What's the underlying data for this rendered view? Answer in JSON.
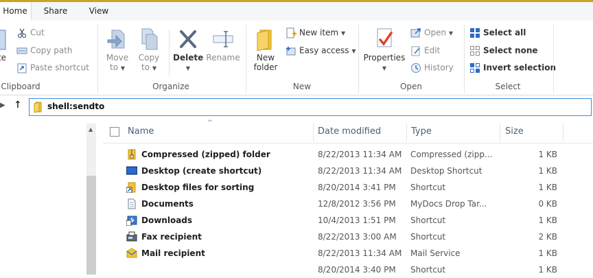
{
  "tabs": [
    "Home",
    "Share",
    "View"
  ],
  "clipboard": {
    "paste_partial": "te",
    "cut": "Cut",
    "copy_path": "Copy path",
    "paste_shortcut": "Paste shortcut",
    "label": "Clipboard"
  },
  "organize": {
    "move_to_1": "Move",
    "move_to_2": "to",
    "copy_to_1": "Copy",
    "copy_to_2": "to",
    "delete": "Delete",
    "rename": "Rename",
    "label": "Organize"
  },
  "new": {
    "new_folder_1": "New",
    "new_folder_2": "folder",
    "new_item": "New item",
    "easy_access": "Easy access",
    "label": "New"
  },
  "open": {
    "properties": "Properties",
    "open": "Open",
    "edit": "Edit",
    "history": "History",
    "label": "Open"
  },
  "select": {
    "select_all": "Select all",
    "select_none": "Select none",
    "invert_selection": "Invert selection",
    "label": "Select"
  },
  "address": {
    "path": "shell:sendto"
  },
  "columns": {
    "name": "Name",
    "date": "Date modified",
    "type": "Type",
    "size": "Size"
  },
  "files": [
    {
      "name": "Compressed (zipped) folder",
      "date": "8/22/2013 11:34 AM",
      "type": "Compressed (zipp...",
      "size": "1 KB",
      "icon": "zip-folder-icon"
    },
    {
      "name": "Desktop (create shortcut)",
      "date": "8/22/2013 11:34 AM",
      "type": "Desktop Shortcut",
      "size": "1 KB",
      "icon": "desktop-icon"
    },
    {
      "name": "Desktop files for sorting",
      "date": "8/20/2014 3:41 PM",
      "type": "Shortcut",
      "size": "1 KB",
      "icon": "shortcut-folder-icon"
    },
    {
      "name": "Documents",
      "date": "12/8/2012 3:56 PM",
      "type": "MyDocs Drop Tar...",
      "size": "0 KB",
      "icon": "document-icon"
    },
    {
      "name": "Downloads",
      "date": "10/4/2013 1:51 PM",
      "type": "Shortcut",
      "size": "1 KB",
      "icon": "downloads-icon"
    },
    {
      "name": "Fax recipient",
      "date": "8/22/2013 3:00 AM",
      "type": "Shortcut",
      "size": "2 KB",
      "icon": "fax-icon"
    },
    {
      "name": "Mail recipient",
      "date": "8/22/2013 11:34 AM",
      "type": "Mail Service",
      "size": "1 KB",
      "icon": "mail-icon"
    },
    {
      "name": "",
      "date": "8/20/2014 3:40 PM",
      "type": "Shortcut",
      "size": "1 KB",
      "icon": ""
    }
  ]
}
